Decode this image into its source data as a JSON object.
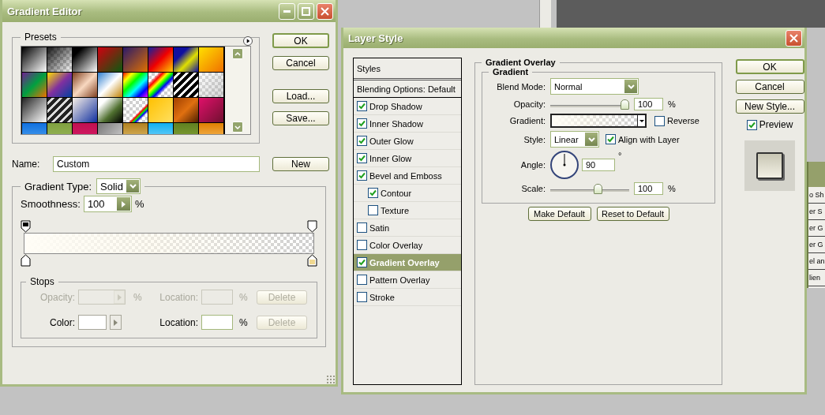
{
  "gradient_editor": {
    "title": "Gradient Editor",
    "presets": {
      "label": "Presets"
    },
    "buttons": [
      {
        "label": "OK",
        "default": true
      },
      {
        "label": "Cancel",
        "default": false
      },
      {
        "label": "Load...",
        "default": false
      },
      {
        "label": "Save...",
        "default": false
      }
    ],
    "name": {
      "label": "Name:",
      "value": "Custom"
    },
    "new_button": "New",
    "gradient_type": {
      "label": "Gradient Type:",
      "value": "Solid"
    },
    "smoothness": {
      "label": "Smoothness:",
      "value": "100",
      "unit": "%"
    },
    "stops": {
      "title": "Stops",
      "rows": [
        {
          "kind": "opacity",
          "label": "Opacity:",
          "unit": "%",
          "location_label": "Location:",
          "location_unit": "%",
          "delete": "Delete",
          "disabled": true
        },
        {
          "kind": "color",
          "label": "Color:",
          "location_label": "Location:",
          "location_unit": "%",
          "delete": "Delete",
          "disabled": false
        }
      ]
    }
  },
  "layer_style": {
    "title": "Layer Style",
    "styles": [
      {
        "kind": "header",
        "label": "Styles",
        "selected": false
      },
      {
        "kind": "option",
        "label": "Blending Options: Default",
        "selected": false
      },
      {
        "kind": "effect",
        "label": "Drop Shadow",
        "checked": true,
        "selected": false
      },
      {
        "kind": "effect",
        "label": "Inner Shadow",
        "checked": true,
        "selected": false
      },
      {
        "kind": "effect",
        "label": "Outer Glow",
        "checked": true,
        "selected": false
      },
      {
        "kind": "effect",
        "label": "Inner Glow",
        "checked": true,
        "selected": false
      },
      {
        "kind": "effect",
        "label": "Bevel and Emboss",
        "checked": true,
        "selected": false,
        "children": [
          {
            "kind": "effect",
            "label": "Contour",
            "checked": true,
            "selected": false
          },
          {
            "kind": "effect",
            "label": "Texture",
            "checked": false,
            "selected": false
          }
        ]
      },
      {
        "kind": "effect",
        "label": "Satin",
        "checked": false,
        "selected": false
      },
      {
        "kind": "effect",
        "label": "Color Overlay",
        "checked": false,
        "selected": false
      },
      {
        "kind": "effect",
        "label": "Gradient Overlay",
        "checked": true,
        "selected": true
      },
      {
        "kind": "effect",
        "label": "Pattern Overlay",
        "checked": false,
        "selected": false
      },
      {
        "kind": "effect",
        "label": "Stroke",
        "checked": false,
        "selected": false
      }
    ],
    "panel": {
      "title": "Gradient Overlay",
      "group": "Gradient",
      "blend_mode": {
        "label": "Blend Mode:",
        "value": "Normal"
      },
      "opacity": {
        "label": "Opacity:",
        "level": 1,
        "value": "100",
        "unit": "%"
      },
      "gradient": {
        "label": "Gradient:",
        "reverse": {
          "label": "Reverse",
          "checked": false
        }
      },
      "style": {
        "label": "Style:",
        "value": "Linear",
        "align": {
          "label": "Align with Layer",
          "checked": true
        }
      },
      "angle": {
        "label": "Angle:",
        "value": "90",
        "unit": "°"
      },
      "scale": {
        "label": "Scale:",
        "level": 0.62,
        "value": "100",
        "unit": "%"
      },
      "buttons": [
        "Make Default",
        "Reset to Default"
      ]
    },
    "buttons": [
      {
        "label": "OK",
        "default": true
      },
      {
        "label": "Cancel",
        "default": false
      },
      {
        "label": "New Style...",
        "default": false
      }
    ],
    "preview": {
      "label": "Preview",
      "checked": true
    }
  },
  "background_panel": {
    "items": [
      "o Sh",
      "er S",
      "er G",
      "er G",
      "el an",
      "lien"
    ]
  }
}
